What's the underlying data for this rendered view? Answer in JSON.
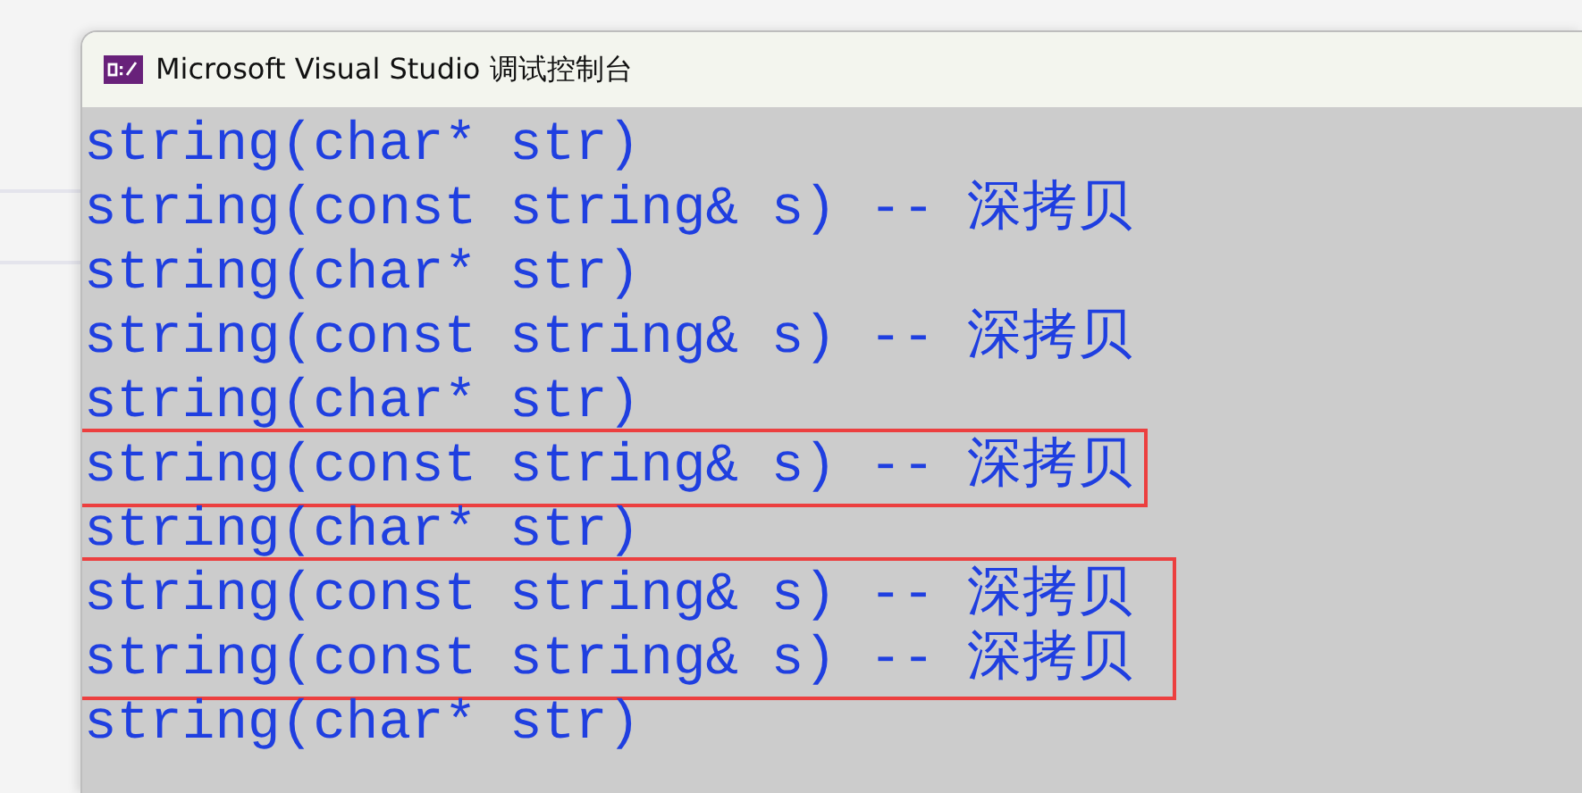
{
  "window": {
    "title": "Microsoft Visual Studio 调试控制台"
  },
  "console": [
    {
      "kind": "line",
      "text": "string(char* str)"
    },
    {
      "kind": "line",
      "text": "string(const string& s) -- 深拷贝"
    },
    {
      "kind": "line",
      "text": "string(char* str)"
    },
    {
      "kind": "line",
      "text": "string(const string& s) -- 深拷贝"
    },
    {
      "kind": "line",
      "text": "string(char* str)"
    },
    {
      "kind": "highlight",
      "lines": [
        "string(const string& s) -- 深拷贝"
      ]
    },
    {
      "kind": "line",
      "text": "string(char* str)"
    },
    {
      "kind": "highlight",
      "lines": [
        "string(const string& s) -- 深拷贝",
        "string(const string& s) -- 深拷贝"
      ]
    },
    {
      "kind": "line",
      "text": "string(char* str)"
    }
  ]
}
